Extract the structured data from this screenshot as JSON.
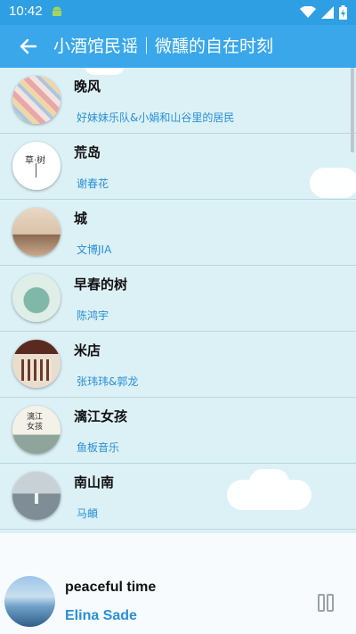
{
  "status_bar": {
    "time": "10:42"
  },
  "app_bar": {
    "title": "小酒馆民谣｜微醺的自在时刻"
  },
  "songs": [
    {
      "title": "晚风",
      "artist": "好妹妹乐队&小娟和山谷里的居民"
    },
    {
      "title": "荒岛",
      "artist": "谢春花"
    },
    {
      "title": "城",
      "artist": "文博JIA"
    },
    {
      "title": "早春的树",
      "artist": "陈鸿宇"
    },
    {
      "title": "米店",
      "artist": "张玮玮&郭龙"
    },
    {
      "title": "漓江女孩",
      "artist": "鱼板音乐"
    },
    {
      "title": "南山南",
      "artist": "马頔"
    }
  ],
  "thumb_text": {
    "huangdao": "草·树",
    "lijiang": "漓江\n女孩"
  },
  "player": {
    "title": "peaceful time",
    "artist": "Elina Sade"
  },
  "colors": {
    "accent": "#3aa7ea",
    "status": "#2f9fe3",
    "artist_text": "#2a8fd6",
    "list_bg": "#dcf1f6"
  }
}
